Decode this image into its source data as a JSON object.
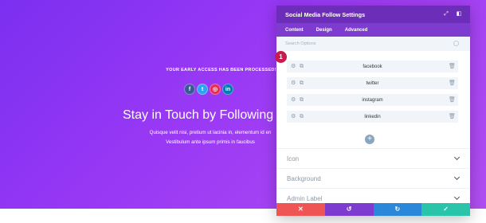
{
  "page": {
    "early_access": "YOUR EARLY ACCESS HAS BEEN PROCESSED!",
    "social_icons": [
      {
        "name": "facebook-icon",
        "glyph": "f",
        "color": "#3b5998"
      },
      {
        "name": "twitter-icon",
        "glyph": "t",
        "color": "#2ea3f2"
      },
      {
        "name": "instagram-icon",
        "glyph": "◎",
        "color": "#ea2c59"
      },
      {
        "name": "linkedin-icon",
        "glyph": "in",
        "color": "#007bb6"
      }
    ],
    "headline": "Stay in Touch by Following",
    "body_lines": [
      "Quisque velit nisi, pretium ut lacinia in, elementum id en",
      "Vestibulum ante ipsum primis in faucibus"
    ]
  },
  "modal": {
    "title": "Social Media Follow Settings",
    "tabs": [
      {
        "label": "Content"
      },
      {
        "label": "Design"
      },
      {
        "label": "Advanced"
      }
    ],
    "search_placeholder": "Search Options",
    "items": [
      {
        "label": "facebook"
      },
      {
        "label": "twitter"
      },
      {
        "label": "instagram"
      },
      {
        "label": "linkedin"
      }
    ],
    "add_icon": "+",
    "sections": [
      {
        "label": "Icon"
      },
      {
        "label": "Background"
      },
      {
        "label": "Admin Label"
      }
    ],
    "footer": {
      "cancel": "✕",
      "undo": "↺",
      "redo": "↻",
      "save": "✓"
    }
  },
  "marker": "1",
  "colors": {
    "modal_header": "#6c2eb9",
    "modal_tabs": "#7e3bd0",
    "cancel": "#ef5555",
    "undo": "#7e3bd0",
    "redo": "#2b87da",
    "save": "#29c4a9",
    "marker": "#c61c4f"
  }
}
